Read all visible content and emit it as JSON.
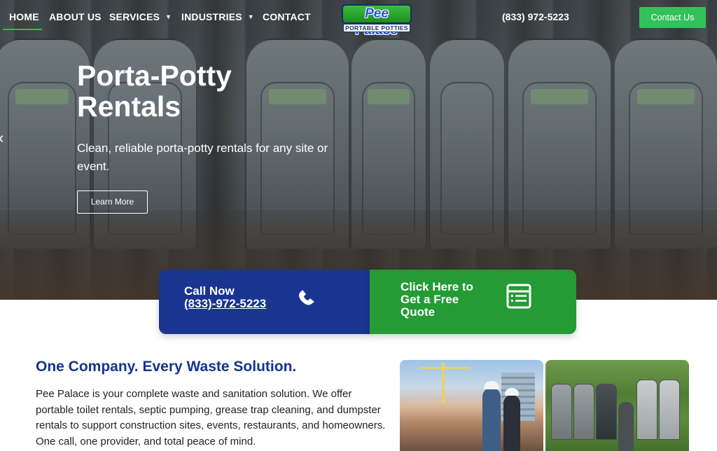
{
  "nav": {
    "items": [
      {
        "label": "HOME",
        "active": true
      },
      {
        "label": "ABOUT US",
        "dropdown": false
      },
      {
        "label": "SERVICES",
        "dropdown": true
      },
      {
        "label": "INDUSTRIES",
        "dropdown": true
      },
      {
        "label": "CONTACT",
        "dropdown": false
      }
    ],
    "caret_glyph": "▼",
    "phone": "(833) 972-5223",
    "contact_button": "Contact Us"
  },
  "logo": {
    "top_text": "Pee Palace",
    "bottom_text": "PORTABLE POTTIES"
  },
  "hero": {
    "title": "Porta-Potty Rentals",
    "subtitle": "Clean, reliable porta-potty rentals for any site or event.",
    "button": "Learn More",
    "prev_arrow_icon": "chevron-left-icon"
  },
  "cta": {
    "call_title": "Call Now",
    "call_number": "(833)-972-5223",
    "call_icon": "phone-icon",
    "quote_text": "Click Here to Get a Free Quote",
    "quote_icon": "form-icon",
    "colors": {
      "call": "#1a3591",
      "quote": "#249b35"
    }
  },
  "section": {
    "title": "One Company. Every Waste Solution.",
    "body": "Pee Palace is your complete waste and sanitation solution. We offer portable toilet rentals, septic pumping, grease trap cleaning, and dumpster rentals to support construction sites, events, restaurants, and homeowners. One call, one provider, and total peace of mind."
  },
  "colors": {
    "accent_green": "#33c25a",
    "brand_blue": "#17338f"
  }
}
